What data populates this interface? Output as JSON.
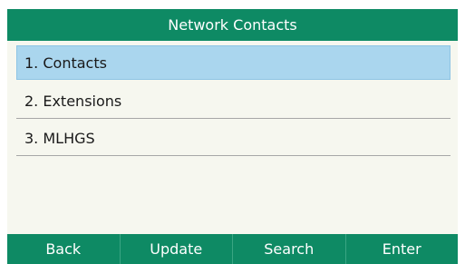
{
  "header": {
    "title": "Network Contacts"
  },
  "list": {
    "items": [
      {
        "label": "1. Contacts"
      },
      {
        "label": "2. Extensions"
      },
      {
        "label": "3. MLHGS"
      }
    ],
    "selected_index": 0
  },
  "softkeys": [
    {
      "label": "Back"
    },
    {
      "label": "Update"
    },
    {
      "label": "Search"
    },
    {
      "label": "Enter"
    }
  ],
  "colors": {
    "header_bg": "#0e8a64",
    "selected_bg": "#aad6ee",
    "list_bg": "#f6f7ef"
  }
}
